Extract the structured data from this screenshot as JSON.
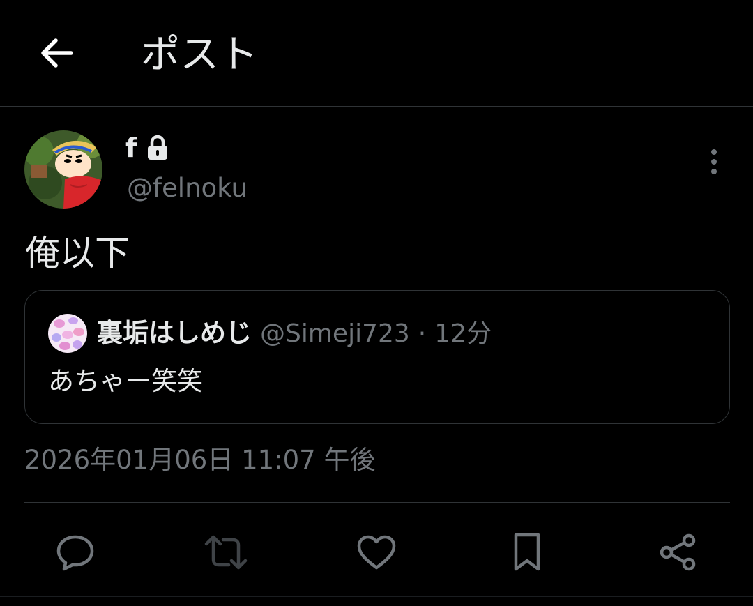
{
  "header": {
    "title": "ポスト",
    "back_icon": "arrow-left-icon"
  },
  "author": {
    "display_name": "f",
    "protected_icon": "lock-icon",
    "handle": "@felnoku"
  },
  "post": {
    "text": "俺以下",
    "timestamp": "2026年01月06日 11:07 午後"
  },
  "quote": {
    "display_name": "裏垢はしめじ",
    "handle": "@Simeji723",
    "separator": "·",
    "time": "12分",
    "text": "あちゃー笑笑"
  },
  "actions": [
    {
      "name": "reply",
      "icon": "comment-icon"
    },
    {
      "name": "repost",
      "icon": "repost-icon"
    },
    {
      "name": "like",
      "icon": "heart-icon"
    },
    {
      "name": "bookmark",
      "icon": "bookmark-icon"
    },
    {
      "name": "share",
      "icon": "share-icon"
    }
  ],
  "colors": {
    "background": "#000000",
    "text_primary": "#e7e9ea",
    "text_secondary": "#71767b",
    "border": "#2f3336",
    "icon": "#71767b"
  }
}
